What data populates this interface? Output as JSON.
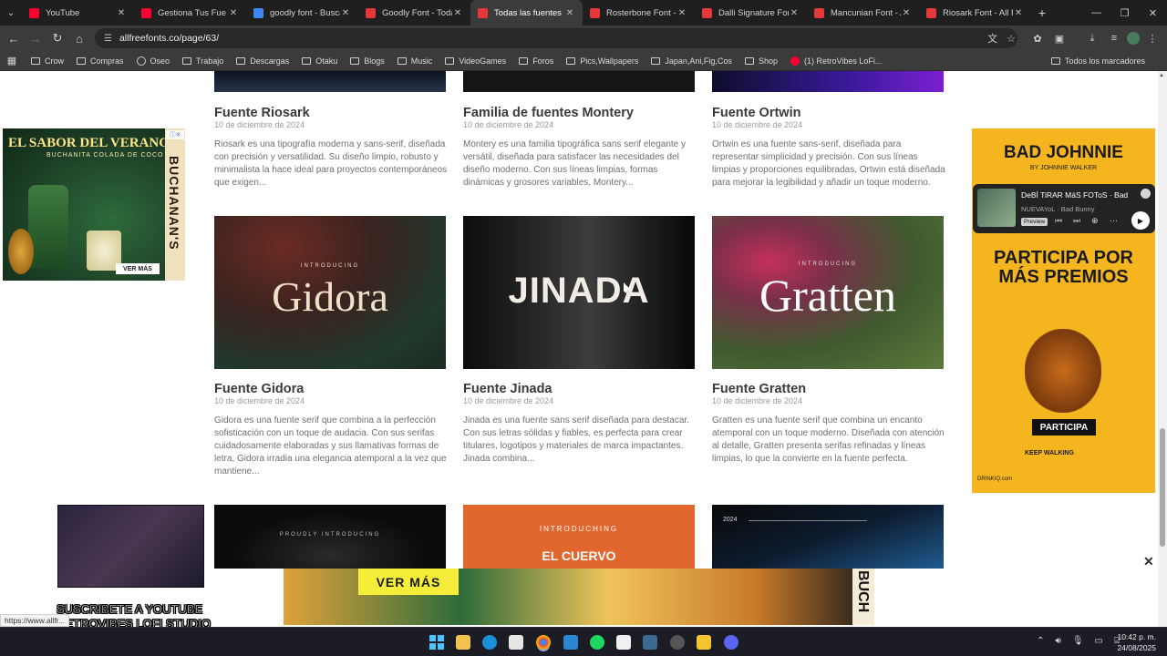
{
  "browser": {
    "tabs": [
      {
        "title": "YouTube",
        "favicon_color": "#ff0033",
        "active": false
      },
      {
        "title": "Gestiona Tus Fue",
        "favicon_color": "#ff0033",
        "active": false
      },
      {
        "title": "goodly font - Buscar",
        "favicon_color": "#4285f4",
        "active": false
      },
      {
        "title": "Goodly Font - Todas",
        "favicon_color": "#e5383b",
        "active": false
      },
      {
        "title": "Todas las fuentes gra",
        "favicon_color": "#e5383b",
        "active": true
      },
      {
        "title": "Rosterbone Font - All",
        "favicon_color": "#e5383b",
        "active": false
      },
      {
        "title": "Dalli Signature Font",
        "favicon_color": "#e5383b",
        "active": false
      },
      {
        "title": "Mancunian Font - All",
        "favicon_color": "#e5383b",
        "active": false
      },
      {
        "title": "Riosark Font - All Fre",
        "favicon_color": "#e5383b",
        "active": false
      }
    ],
    "url": "allfreefonts.co/page/63/",
    "bookmarks": [
      {
        "label": "Crow",
        "type": "folder"
      },
      {
        "label": "Compras",
        "type": "folder"
      },
      {
        "label": "Oseo",
        "type": "site"
      },
      {
        "label": "Trabajo",
        "type": "folder"
      },
      {
        "label": "Descargas",
        "type": "folder"
      },
      {
        "label": "Otaku",
        "type": "folder"
      },
      {
        "label": "Blogs",
        "type": "folder"
      },
      {
        "label": "Music",
        "type": "folder"
      },
      {
        "label": "VideoGames",
        "type": "folder"
      },
      {
        "label": "Foros",
        "type": "folder"
      },
      {
        "label": "Pics,Wallpapers",
        "type": "folder"
      },
      {
        "label": "Japan,Ani,Fig,Cos",
        "type": "folder"
      },
      {
        "label": "Shop",
        "type": "folder"
      },
      {
        "label": "(1) RetroVibes LoFi...",
        "type": "youtube"
      }
    ],
    "all_bookmarks": "Todos los marcadores",
    "status_url": "https://www.allfr..."
  },
  "cards_top": [
    {
      "title": "Fuente Riosark",
      "date": "10 de diciembre de 2024",
      "desc": "Riosark es una tipografía moderna y sans-serif, diseñada con precisión y versatilidad. Su diseño limpio, robusto y minimalista la hace ideal para proyectos contemporáneos que exigen..."
    },
    {
      "title": "Familia de fuentes Montery",
      "date": "10 de diciembre de 2024",
      "desc": "Montery es una familia tipográfica sans serif elegante y versátil, diseñada para satisfacer las necesidades del diseño moderno. Con sus líneas limpias, formas dinámicas y grosores variables, Montery..."
    },
    {
      "title": "Fuente Ortwin",
      "date": "10 de diciembre de 2024",
      "desc": "Ortwin es una fuente sans-serif, diseñada para representar simplicidad y precisión. Con sus líneas limpias y proporciones equilibradas, Ortwin está diseñada para mejorar la legibilidad y añadir un toque moderno."
    }
  ],
  "cards_mid": [
    {
      "title": "Fuente Gidora",
      "date": "10 de diciembre de 2024",
      "image_text": "Gidora",
      "intro": "INTRODUCING",
      "desc": "Gidora es una fuente serif que combina a la perfección sofisticación con un toque de audacia. Con sus serifas cuidadosamente elaboradas y sus llamativas formas de letra, Gidora irradia una elegancia atemporal a la vez que mantiene..."
    },
    {
      "title": "Fuente Jinada",
      "date": "10 de diciembre de 2024",
      "image_text": "JINADA",
      "intro": "",
      "desc": "Jinada es una fuente sans serif diseñada para destacar. Con sus letras sólidas y fiables, es perfecta para crear titulares, logotipos y materiales de marca impactantes. Jinada combina..."
    },
    {
      "title": "Fuente Gratten",
      "date": "10 de diciembre de 2024",
      "image_text": "Gratten",
      "intro": "INTRODUCING",
      "desc": "Gratten es una fuente serif que combina un encanto atemporal con un toque moderno. Diseñada con atención al detalle, Gratten presenta serifas refinadas y líneas limpias, lo que la convierte en la fuente perfecta."
    }
  ],
  "cards_bottom": [
    {
      "intro": "PROUDLY INTRODUCING"
    },
    {
      "intro": "INTRODUCHING",
      "image_text": "EL CUERVO"
    },
    {
      "intro": "2024"
    }
  ],
  "ads": {
    "left": {
      "headline": "EL SABOR DEL VERANO",
      "sub": "BUCHANITA COLADA DE COCO",
      "brand": "BUCHANAN'S",
      "cta": "VER MÁS"
    },
    "right": {
      "brand": "BAD JOHNNIE",
      "sub": "BY JOHNNIE WALKER",
      "headline": "PARTICIPA POR MÁS PREMIOS",
      "cta": "PARTICIPA",
      "tagline": "KEEP WALKING",
      "site": "DRINKIQ.com"
    },
    "bottom": {
      "cta": "VER MÁS",
      "brand": "BUCH"
    }
  },
  "music_player": {
    "song": "DeBÍ TiRAR MáS FOToS",
    "artist_top": "Bad Bunny",
    "artist": "NUEVAYoL · Bad Bunny",
    "badge": "Preview"
  },
  "overlay": {
    "line1": "SUSCRIBETE A YOUTUBE",
    "line2": "RETROVIBES LOFI STUDIO"
  },
  "taskbar": {
    "time": "10:42 p. m.",
    "date": "24/08/2025"
  }
}
